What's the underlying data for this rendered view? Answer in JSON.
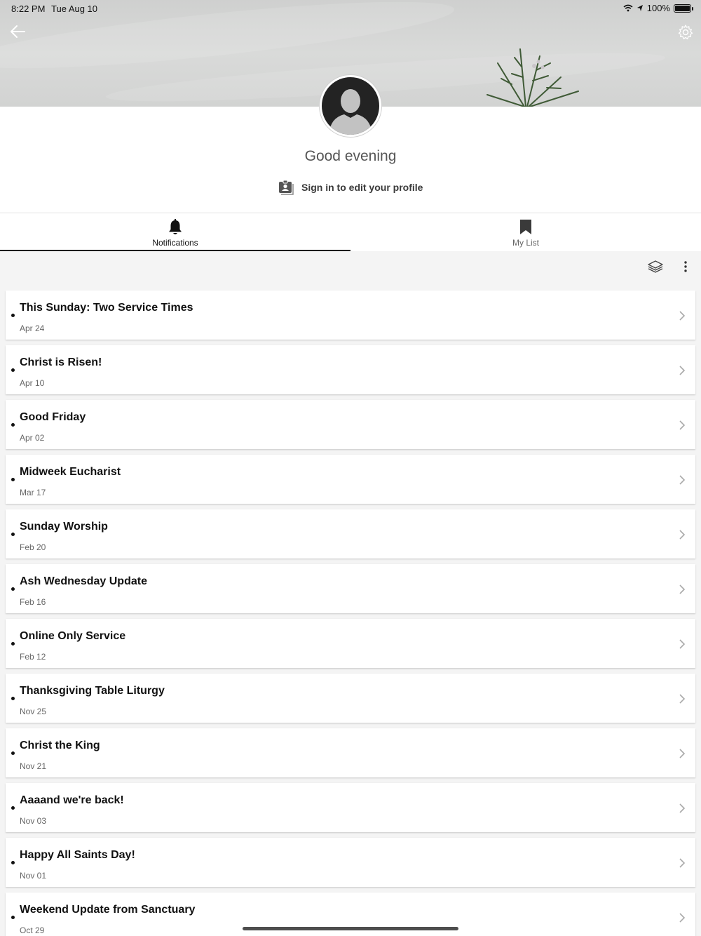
{
  "status_bar": {
    "time": "8:22 PM",
    "date": "Tue Aug 10",
    "battery": "100%"
  },
  "icons": {
    "back": "arrow-left-icon",
    "settings": "gear-icon",
    "avatar": "user-silhouette-icon",
    "signin": "contact-card-icon",
    "notifications": "bell-icon",
    "my_list": "bookmark-icon",
    "layers": "layers-icon",
    "more": "vertical-dots-icon",
    "chevron": "chevron-right-icon"
  },
  "profile": {
    "greeting": "Good evening",
    "signin_label": "Sign in to edit your profile"
  },
  "tabs": [
    {
      "label": "Notifications",
      "active": true
    },
    {
      "label": "My List",
      "active": false
    }
  ],
  "notifications": [
    {
      "title": "This Sunday: Two Service Times",
      "date": "Apr 24"
    },
    {
      "title": "Christ is Risen!",
      "date": "Apr 10"
    },
    {
      "title": "Good Friday",
      "date": "Apr 02"
    },
    {
      "title": "Midweek Eucharist",
      "date": "Mar 17"
    },
    {
      "title": "Sunday Worship",
      "date": "Feb 20"
    },
    {
      "title": "Ash Wednesday Update",
      "date": "Feb 16"
    },
    {
      "title": "Online Only Service",
      "date": "Feb 12"
    },
    {
      "title": "Thanksgiving Table Liturgy",
      "date": "Nov 25"
    },
    {
      "title": "Christ the King",
      "date": "Nov 21"
    },
    {
      "title": "Aaaand we're back!",
      "date": "Nov 03"
    },
    {
      "title": "Happy All Saints Day!",
      "date": "Nov 01"
    },
    {
      "title": "Weekend Update from Sanctuary",
      "date": "Oct 29"
    }
  ]
}
